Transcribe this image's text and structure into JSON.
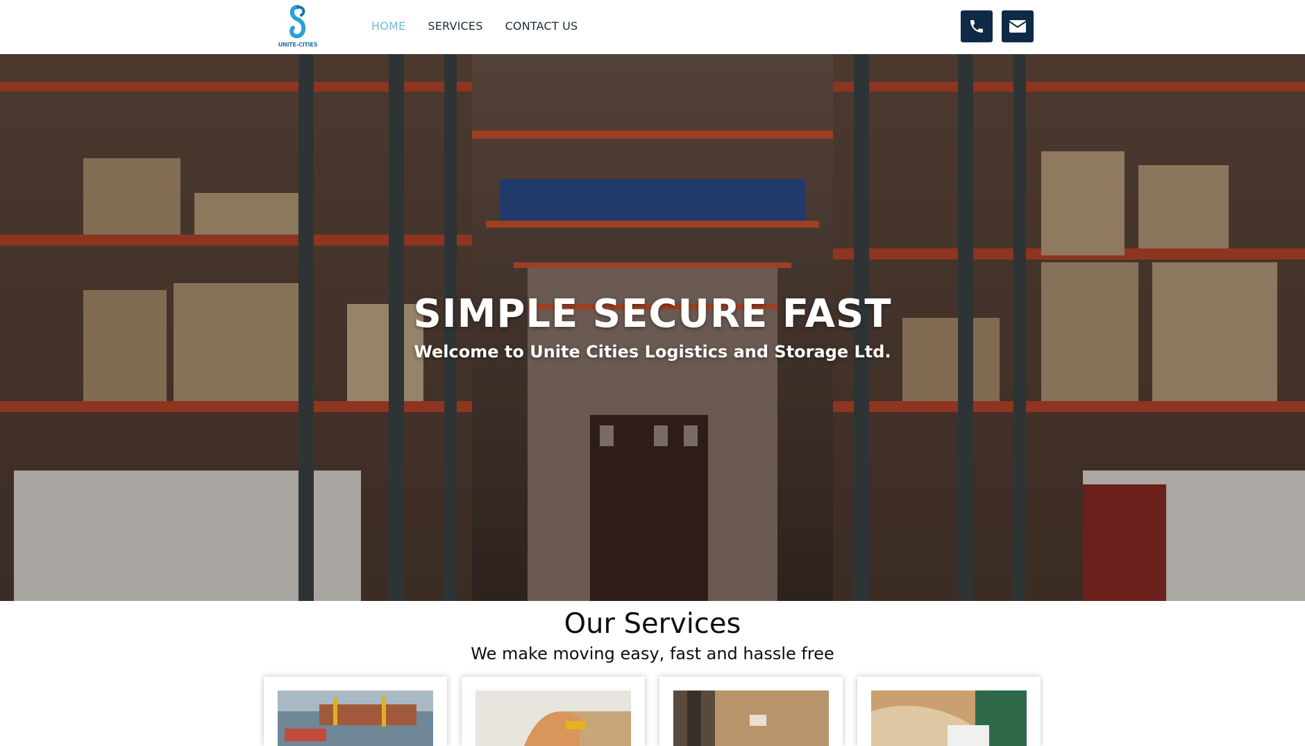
{
  "header": {
    "logo_text": "UNITE-CITIES",
    "nav": [
      {
        "label": "HOME",
        "active": true
      },
      {
        "label": "SERVICES",
        "active": false
      },
      {
        "label": "CONTACT US",
        "active": false
      }
    ],
    "phone_icon": "phone-icon",
    "mail_icon": "envelope-icon"
  },
  "hero": {
    "title": "SIMPLE SECURE FAST",
    "subtitle": "Welcome to Unite Cities Logistics and Storage Ltd."
  },
  "services": {
    "title": "Our Services",
    "subtitle": "We make moving easy, fast and hassle free",
    "cards": [
      {
        "image": "port-cargo-image"
      },
      {
        "image": "delivery-worker-image"
      },
      {
        "image": "fragile-box-image"
      },
      {
        "image": "electronics-image"
      }
    ]
  },
  "colors": {
    "nav_active": "#6cbbd6",
    "nav_text": "#1e2a3a",
    "icon_button_bg": "#0e2a47",
    "logo_blue": "#1d6fa8"
  }
}
